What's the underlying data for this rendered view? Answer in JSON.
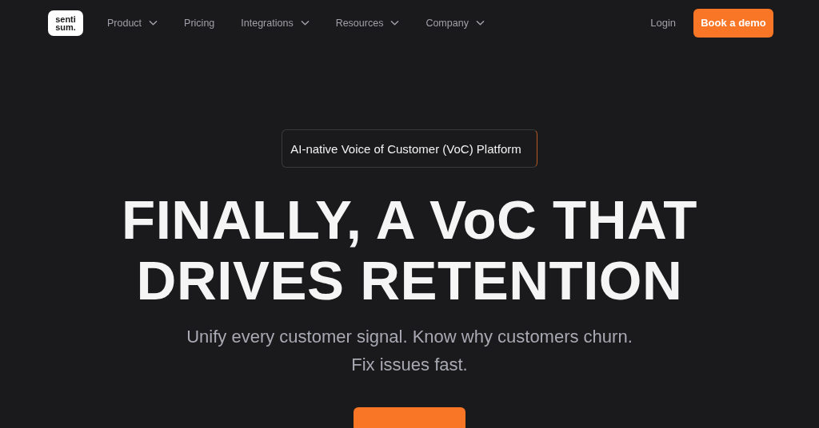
{
  "logo": {
    "line_1": "senti",
    "line_2": "sum."
  },
  "nav": {
    "items": [
      {
        "label": "Product",
        "dropdown": true
      },
      {
        "label": "Pricing",
        "dropdown": false
      },
      {
        "label": "Integrations",
        "dropdown": true
      },
      {
        "label": "Resources",
        "dropdown": true
      },
      {
        "label": "Company",
        "dropdown": true
      }
    ],
    "login": "Login",
    "cta": "Book a demo"
  },
  "hero": {
    "badge": "AI-native Voice of Customer (VoC) Platform",
    "headline": [
      "FINALLY, A VoC THAT",
      "DRIVES RETENTION"
    ],
    "subtitle": [
      "Unify every customer signal. Know why customers churn.",
      "Fix issues fast."
    ]
  }
}
